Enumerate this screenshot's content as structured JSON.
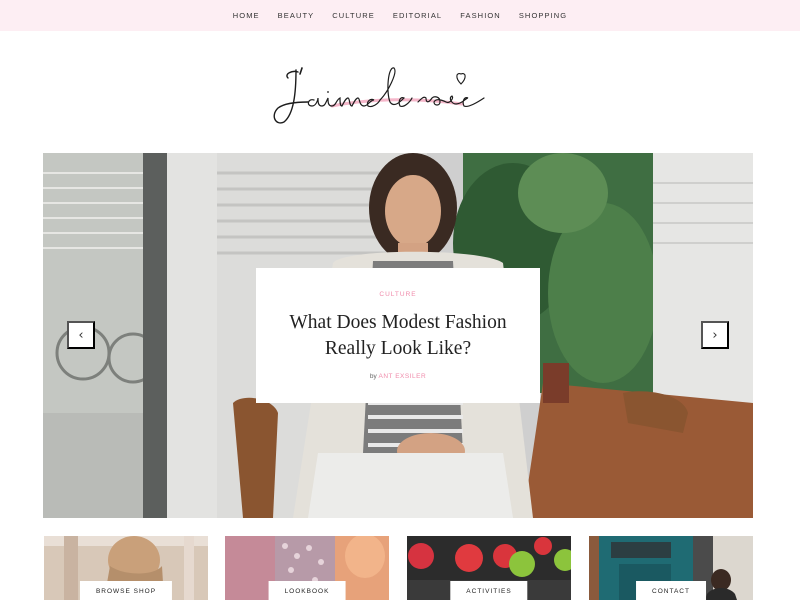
{
  "nav": {
    "items": [
      "HOME",
      "BEAUTY",
      "CULTURE",
      "EDITORIAL",
      "FASHION",
      "SHOPPING"
    ]
  },
  "logo": {
    "text": "J'aime le rose",
    "accent": "#f2a5bd"
  },
  "hero": {
    "category": "CULTURE",
    "title": "What Does Modest Fashion Really Look Like?",
    "byline_prefix": "by",
    "author": "ANT EXSILER",
    "prev_icon": "chevron-left-icon",
    "next_icon": "chevron-right-icon"
  },
  "tiles": [
    {
      "label": "BROWSE SHOP"
    },
    {
      "label": "LOOKBOOK"
    },
    {
      "label": "ACTIVITIES"
    },
    {
      "label": "CONTACT"
    }
  ],
  "colors": {
    "nav_bg": "#fdeef3",
    "accent_pink": "#f08bab"
  }
}
